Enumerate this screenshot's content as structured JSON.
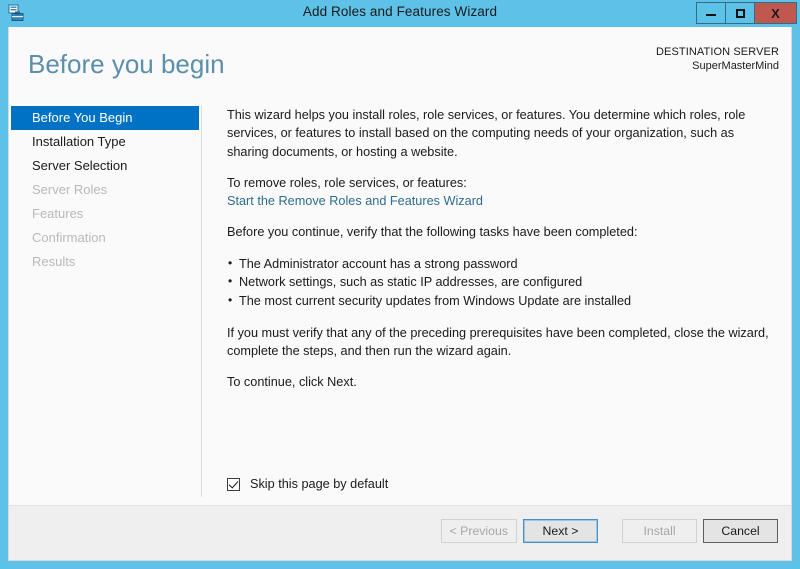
{
  "window": {
    "title": "Add Roles and Features Wizard",
    "app_icon": "server-manager-icon",
    "minimize_label": "Minimize",
    "maximize_label": "Maximize",
    "close_label": "X"
  },
  "header": {
    "page_title": "Before you begin",
    "destination_label": "DESTINATION SERVER",
    "destination_value": "SuperMasterMind"
  },
  "nav": {
    "items": [
      {
        "label": "Before You Begin",
        "state": "selected"
      },
      {
        "label": "Installation Type",
        "state": "enabled"
      },
      {
        "label": "Server Selection",
        "state": "enabled"
      },
      {
        "label": "Server Roles",
        "state": "disabled"
      },
      {
        "label": "Features",
        "state": "disabled"
      },
      {
        "label": "Confirmation",
        "state": "disabled"
      },
      {
        "label": "Results",
        "state": "disabled"
      }
    ]
  },
  "content": {
    "intro": "This wizard helps you install roles, role services, or features. You determine which roles, role services, or features to install based on the computing needs of your organization, such as sharing documents, or hosting a website.",
    "remove_intro": "To remove roles, role services, or features:",
    "remove_link": "Start the Remove Roles and Features Wizard",
    "tasks_intro": "Before you continue, verify that the following tasks have been completed:",
    "tasks": [
      "The Administrator account has a strong password",
      "Network settings, such as static IP addresses, are configured",
      "The most current security updates from Windows Update are installed"
    ],
    "verify_note": "If you must verify that any of the preceding prerequisites have been completed, close the wizard, complete the steps, and then run the wizard again.",
    "continue_note": "To continue, click Next."
  },
  "checkbox": {
    "label": "Skip this page by default",
    "checked": true
  },
  "footer": {
    "buttons": [
      {
        "label": "< Previous",
        "state": "disabled"
      },
      {
        "label": "Next >",
        "state": "focused"
      },
      {
        "label": "Install",
        "state": "disabled"
      },
      {
        "label": "Cancel",
        "state": "strong"
      }
    ]
  },
  "colors": {
    "window_chrome": "#5ec2e8",
    "accent_selected": "#0072c6",
    "title_heading": "#5b8fab",
    "link": "#2e6d8e",
    "close_button": "#c0584f",
    "footer_bg": "#efefef",
    "client_bg": "#fafafa"
  }
}
